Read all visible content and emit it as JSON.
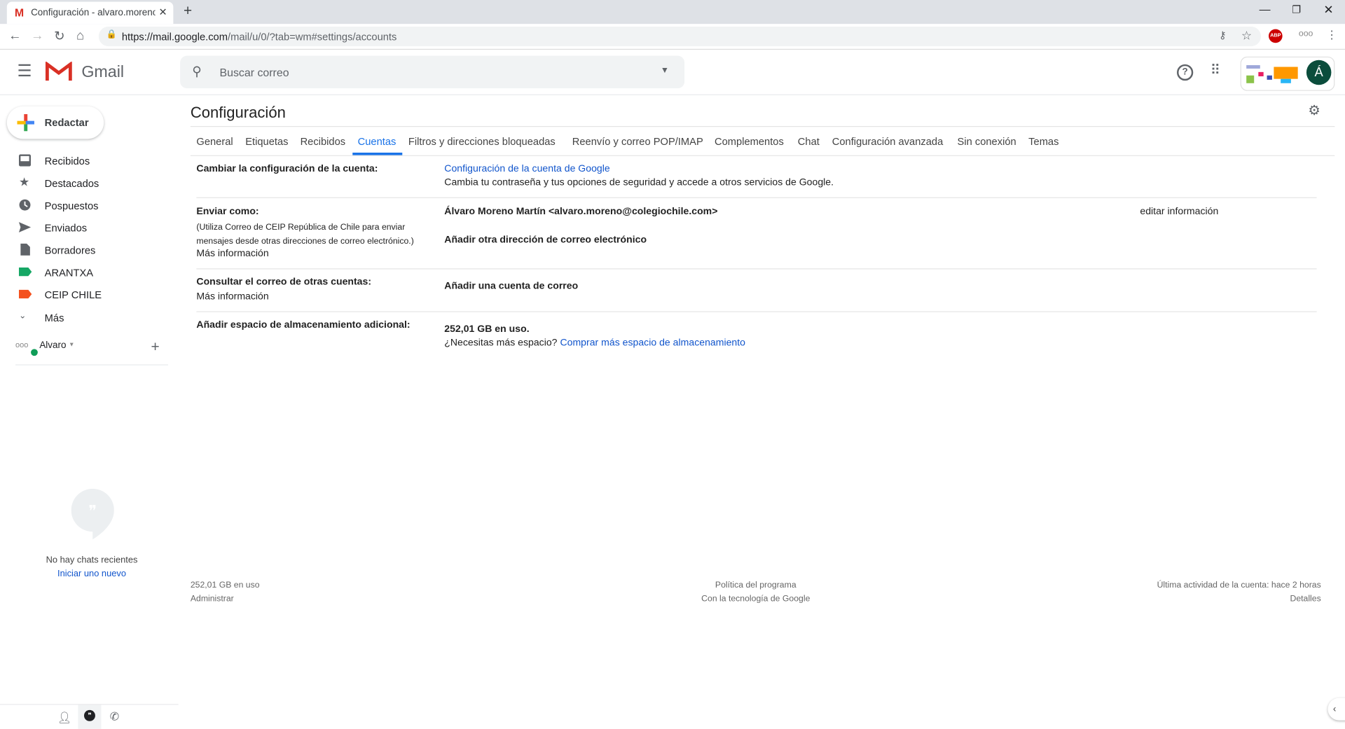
{
  "browser": {
    "tab_title": "Configuración - alvaro.moreno@",
    "url_host": "https://mail.google.com",
    "url_path": "/mail/u/0/?tab=wm#settings/accounts",
    "abp_label": "ABP"
  },
  "header": {
    "app_name": "Gmail",
    "search_placeholder": "Buscar correo",
    "avatar_letter": "Á"
  },
  "sidebar": {
    "compose_label": "Redactar",
    "items": [
      {
        "label": "Recibidos",
        "icon": "inbox-icon"
      },
      {
        "label": "Destacados",
        "icon": "star-icon"
      },
      {
        "label": "Pospuestos",
        "icon": "clock-icon"
      },
      {
        "label": "Enviados",
        "icon": "send-icon"
      },
      {
        "label": "Borradores",
        "icon": "draft-icon"
      },
      {
        "label": "ARANTXA",
        "icon": "label-icon",
        "color": "#16a765"
      },
      {
        "label": "CEIP CHILE",
        "icon": "label-icon",
        "color": "#f4511e"
      },
      {
        "label": "Más",
        "icon": "chevron-down-icon"
      }
    ],
    "hangouts_user": "Alvaro",
    "no_chats": "No hay chats recientes",
    "start_new": "Iniciar uno nuevo"
  },
  "settings": {
    "title": "Configuración",
    "active_tab": "Cuentas",
    "tabs": [
      "General",
      "Etiquetas",
      "Recibidos",
      "Cuentas",
      "Filtros y direcciones bloqueadas",
      "Reenvío y correo POP/IMAP",
      "Complementos",
      "Chat",
      "Configuración avanzada",
      "Sin conexión",
      "Temas"
    ],
    "rows": {
      "account": {
        "label": "Cambiar la configuración de la cuenta:",
        "link": "Configuración de la cuenta de Google",
        "desc": "Cambia tu contraseña y tus opciones de seguridad y accede a otros servicios de Google."
      },
      "send_as": {
        "label": "Enviar como:",
        "note": "(Utiliza Correo de CEIP República de Chile para enviar mensajes desde otras direcciones de correo electrónico.)",
        "more": "Más información",
        "identity": "Álvaro Moreno Martín <alvaro.moreno@colegiochile.com>",
        "edit": "editar información",
        "add": "Añadir otra dirección de correo electrónico"
      },
      "check_mail": {
        "label": "Consultar el correo de otras cuentas:",
        "more": "Más información",
        "add": "Añadir una cuenta de correo"
      },
      "storage": {
        "label": "Añadir espacio de almacenamiento adicional:",
        "usage": "252,01 GB en uso.",
        "question": "¿Necesitas más espacio?",
        "buy": "Comprar más espacio de almacenamiento"
      }
    }
  },
  "footer": {
    "usage": "252,01 GB en uso",
    "manage": "Administrar",
    "policy": "Política del programa",
    "powered": "Con la tecnología de Google",
    "activity": "Última actividad de la cuenta: hace 2 horas",
    "details": "Detalles"
  },
  "colors": {
    "link": "#1155cc",
    "active_tab": "#1a73e8",
    "avatar": "#0b4d3c"
  }
}
